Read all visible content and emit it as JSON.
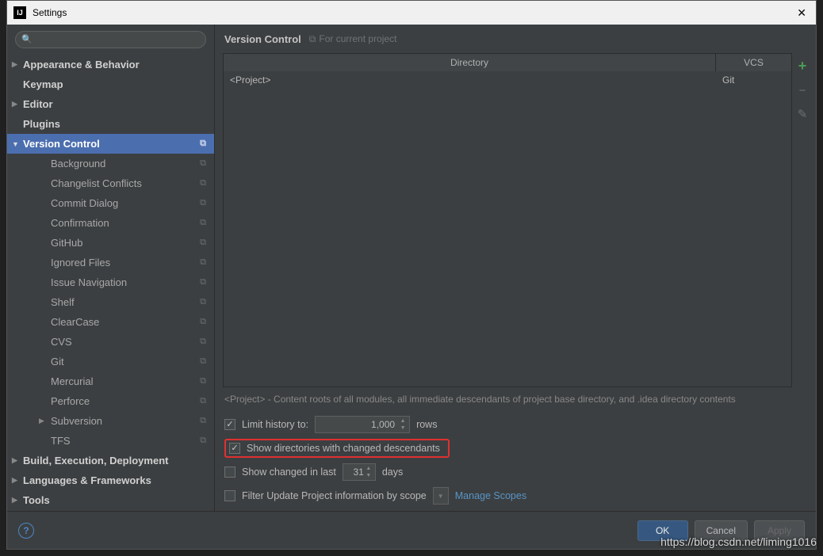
{
  "window": {
    "title": "Settings"
  },
  "search": {
    "placeholder": ""
  },
  "sidebar": {
    "items": [
      {
        "label": "Appearance & Behavior",
        "bold": true,
        "arrow": "▶"
      },
      {
        "label": "Keymap",
        "bold": true
      },
      {
        "label": "Editor",
        "bold": true,
        "arrow": "▶"
      },
      {
        "label": "Plugins",
        "bold": true
      },
      {
        "label": "Version Control",
        "bold": true,
        "arrow": "▼",
        "selected": true,
        "copy": true
      },
      {
        "label": "Background",
        "child": true,
        "copy": true
      },
      {
        "label": "Changelist Conflicts",
        "child": true,
        "copy": true
      },
      {
        "label": "Commit Dialog",
        "child": true,
        "copy": true
      },
      {
        "label": "Confirmation",
        "child": true,
        "copy": true
      },
      {
        "label": "GitHub",
        "child": true,
        "copy": true
      },
      {
        "label": "Ignored Files",
        "child": true,
        "copy": true
      },
      {
        "label": "Issue Navigation",
        "child": true,
        "copy": true
      },
      {
        "label": "Shelf",
        "child": true,
        "copy": true
      },
      {
        "label": "ClearCase",
        "child": true,
        "copy": true
      },
      {
        "label": "CVS",
        "child": true,
        "copy": true
      },
      {
        "label": "Git",
        "child": true,
        "copy": true
      },
      {
        "label": "Mercurial",
        "child": true,
        "copy": true
      },
      {
        "label": "Perforce",
        "child": true,
        "copy": true
      },
      {
        "label": "Subversion",
        "child": true,
        "arrow": "▶",
        "copy": true
      },
      {
        "label": "TFS",
        "child": true,
        "copy": true
      },
      {
        "label": "Build, Execution, Deployment",
        "bold": true,
        "arrow": "▶"
      },
      {
        "label": "Languages & Frameworks",
        "bold": true,
        "arrow": "▶"
      },
      {
        "label": "Tools",
        "bold": true,
        "arrow": "▶"
      }
    ]
  },
  "main": {
    "title": "Version Control",
    "subtitle": "For current project",
    "table": {
      "headers": {
        "dir": "Directory",
        "vcs": "VCS"
      },
      "rows": [
        {
          "dir": "<Project>",
          "vcs": "Git"
        }
      ]
    },
    "description": "<Project> - Content roots of all modules, all immediate descendants of project base directory, and .idea directory contents",
    "opts": {
      "limit_label": "Limit history to:",
      "limit_value": "1,000",
      "limit_suffix": "rows",
      "show_dirs": "Show directories with changed descendants",
      "show_changed_label": "Show changed in last",
      "show_changed_value": "31",
      "show_changed_suffix": "days",
      "filter_label": "Filter Update Project information by scope",
      "manage_scopes": "Manage Scopes"
    }
  },
  "footer": {
    "ok": "OK",
    "cancel": "Cancel",
    "apply": "Apply"
  },
  "watermark": "https://blog.csdn.net/liming1016"
}
